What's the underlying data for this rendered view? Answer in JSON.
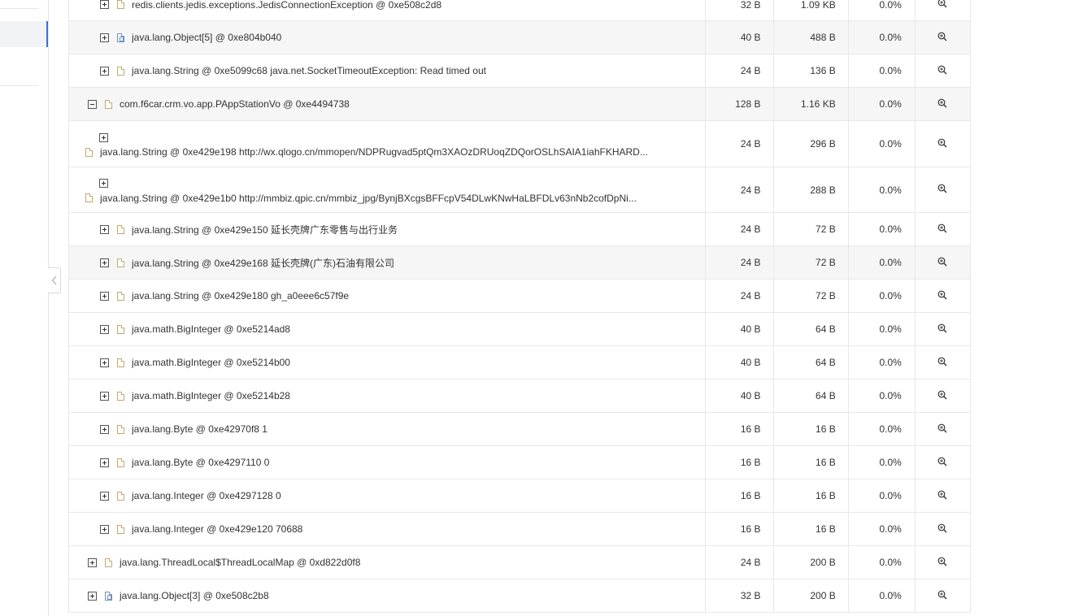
{
  "rows": [
    {
      "name": "redis.clients.jedis.exceptions.JedisConnectionException @ 0xe508c2d8",
      "shallow": "32 B",
      "retained": "1.09 KB",
      "pct": "0.0%",
      "icon": "file-icon"
    },
    {
      "name": "java.lang.Object[5] @ 0xe804b040",
      "shallow": "40 B",
      "retained": "488 B",
      "pct": "0.0%",
      "icon": "array-icon"
    },
    {
      "name": "java.lang.String @ 0xe5099c68 java.net.SocketTimeoutException: Read timed out",
      "shallow": "24 B",
      "retained": "136 B",
      "pct": "0.0%",
      "icon": "file-icon"
    },
    {
      "name": "com.f6car.crm.vo.app.PAppStationVo @ 0xe4494738",
      "shallow": "128 B",
      "retained": "1.16 KB",
      "pct": "0.0%",
      "icon": "file-icon"
    },
    {
      "name": "java.lang.String @ 0xe429e198 http://wx.qlogo.cn/mmopen/NDPRugvad5ptQm3XAOzDRUoqZDQorOSLhSAIA1iahFKHARD...",
      "shallow": "24 B",
      "retained": "296 B",
      "pct": "0.0%",
      "icon": "file-icon"
    },
    {
      "name": "java.lang.String @ 0xe429e1b0 http://mmbiz.qpic.cn/mmbiz_jpg/BynjBXcgsBFFcpV54DLwKNwHaLBFDLv63nNb2cofDpNi...",
      "shallow": "24 B",
      "retained": "288 B",
      "pct": "0.0%",
      "icon": "file-icon"
    },
    {
      "name": "java.lang.String @ 0xe429e150 延长壳牌广东零售与出行业务",
      "shallow": "24 B",
      "retained": "72 B",
      "pct": "0.0%",
      "icon": "file-icon"
    },
    {
      "name": "java.lang.String @ 0xe429e168 延长壳牌(广东)石油有限公司",
      "shallow": "24 B",
      "retained": "72 B",
      "pct": "0.0%",
      "icon": "file-icon"
    },
    {
      "name": "java.lang.String @ 0xe429e180 gh_a0eee6c57f9e",
      "shallow": "24 B",
      "retained": "72 B",
      "pct": "0.0%",
      "icon": "file-icon"
    },
    {
      "name": "java.math.BigInteger @ 0xe5214ad8",
      "shallow": "40 B",
      "retained": "64 B",
      "pct": "0.0%",
      "icon": "file-icon"
    },
    {
      "name": "java.math.BigInteger @ 0xe5214b00",
      "shallow": "40 B",
      "retained": "64 B",
      "pct": "0.0%",
      "icon": "file-icon"
    },
    {
      "name": "java.math.BigInteger @ 0xe5214b28",
      "shallow": "40 B",
      "retained": "64 B",
      "pct": "0.0%",
      "icon": "file-icon"
    },
    {
      "name": "java.lang.Byte @ 0xe42970f8 1",
      "shallow": "16 B",
      "retained": "16 B",
      "pct": "0.0%",
      "icon": "file-icon"
    },
    {
      "name": "java.lang.Byte @ 0xe4297110 0",
      "shallow": "16 B",
      "retained": "16 B",
      "pct": "0.0%",
      "icon": "file-icon"
    },
    {
      "name": "java.lang.Integer @ 0xe4297128 0",
      "shallow": "16 B",
      "retained": "16 B",
      "pct": "0.0%",
      "icon": "file-icon"
    },
    {
      "name": "java.lang.Integer @ 0xe429e120 70688",
      "shallow": "16 B",
      "retained": "16 B",
      "pct": "0.0%",
      "icon": "file-icon"
    },
    {
      "name": "java.lang.ThreadLocal$ThreadLocalMap @ 0xd822d0f8",
      "shallow": "24 B",
      "retained": "200 B",
      "pct": "0.0%",
      "icon": "file-icon"
    },
    {
      "name": "java.lang.Object[3] @ 0xe508c2b8",
      "shallow": "32 B",
      "retained": "200 B",
      "pct": "0.0%",
      "icon": "array-icon"
    }
  ]
}
